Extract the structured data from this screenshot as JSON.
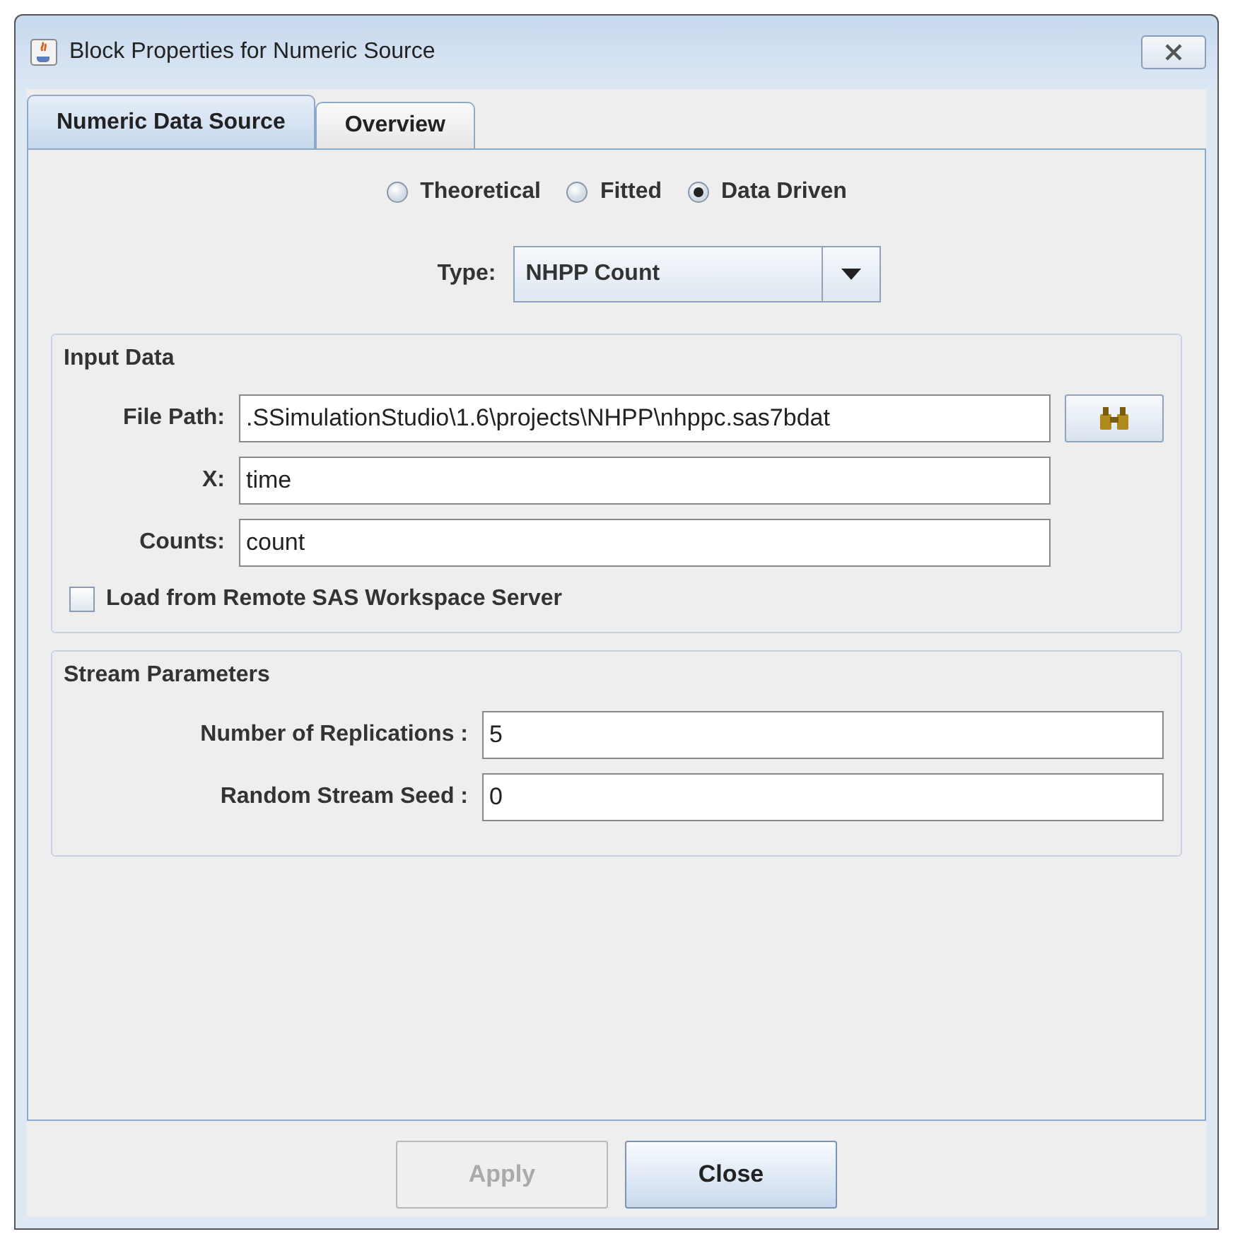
{
  "window": {
    "title": "Block Properties for Numeric Source"
  },
  "tabs": [
    {
      "label": "Numeric Data Source",
      "selected": true
    },
    {
      "label": "Overview",
      "selected": false
    }
  ],
  "source_options": [
    {
      "label": "Theoretical",
      "selected": false
    },
    {
      "label": "Fitted",
      "selected": false
    },
    {
      "label": "Data Driven",
      "selected": true
    }
  ],
  "type": {
    "label": "Type:",
    "value": "NHPP Count"
  },
  "input_data": {
    "title": "Input Data",
    "fields": [
      {
        "label": "File Path:",
        "value": ".SSimulationStudio\\1.6\\projects\\NHPP\\nhppc.sas7bdat",
        "kind": "browse"
      },
      {
        "label": "X:",
        "value": "time",
        "kind": "text"
      },
      {
        "label": "Counts:",
        "value": "count",
        "kind": "text"
      }
    ],
    "remote": {
      "label": "Load from Remote SAS Workspace Server",
      "checked": false
    }
  },
  "stream_parameters": {
    "title": "Stream Parameters",
    "fields": [
      {
        "label": "Number of Replications :",
        "value": "5"
      },
      {
        "label": "Random Stream Seed :",
        "value": "0"
      }
    ]
  },
  "buttons": [
    {
      "label": "Apply",
      "disabled": true
    },
    {
      "label": "Close",
      "disabled": false
    }
  ]
}
